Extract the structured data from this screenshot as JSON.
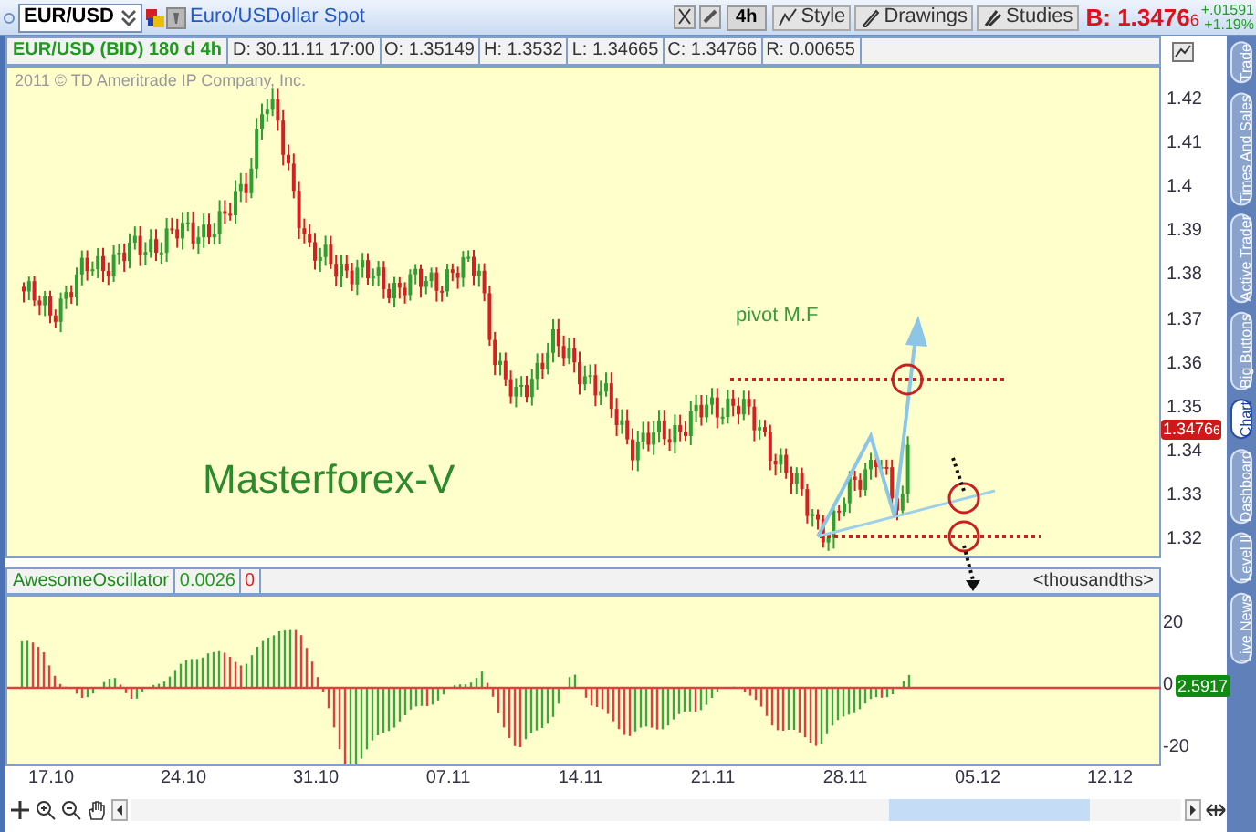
{
  "header": {
    "symbol": "EUR/USD",
    "description": "Euro/USDollar Spot",
    "timeframe": "4h",
    "buttons": [
      {
        "label": "Style"
      },
      {
        "label": "Drawings"
      },
      {
        "label": "Studies"
      }
    ],
    "bid": {
      "label": "B:",
      "price": "1.3476",
      "pip": "6"
    },
    "change": "+.01591",
    "change_percent": "+1.19%"
  },
  "info_bar": [
    "EUR/USD (BID) 180 d 4h",
    "D: 30.11.11 17:00",
    "O: 1.35149",
    "H: 1.3532",
    "L: 1.34665",
    "C: 1.34766",
    "R: 0.00655"
  ],
  "chart": {
    "copyright": "2011 © TD Ameritrade IP Company, Inc.",
    "title": "Masterforex-V",
    "pivot_label": "pivot M.F",
    "price_axis": [
      "1.42",
      "1.41",
      "1.4",
      "1.39",
      "1.38",
      "1.37",
      "1.36",
      "1.35",
      "1.34",
      "1.33",
      "1.32"
    ],
    "price_badge": {
      "price": "1.3476",
      "pip": "6"
    }
  },
  "oscillator": {
    "name": "AwesomeOscillator",
    "value": "0.0026",
    "signal": "0",
    "units": "<thousandths>",
    "axis": [
      "20",
      "0",
      "-20"
    ],
    "badge": "2.5917"
  },
  "date_axis": [
    "17.10",
    "24.10",
    "31.10",
    "07.11",
    "14.11",
    "21.11",
    "28.11",
    "05.12",
    "12.12"
  ],
  "side_tabs": [
    {
      "label": "Trade",
      "selected": false
    },
    {
      "label": "Times And Sales",
      "selected": false
    },
    {
      "label": "Active Trader",
      "selected": false
    },
    {
      "label": "Big Buttons",
      "selected": false
    },
    {
      "label": "Chart",
      "selected": true
    },
    {
      "label": "Dashboard",
      "selected": false
    },
    {
      "label": "Level II",
      "selected": false
    },
    {
      "label": "Live News",
      "selected": false
    }
  ]
}
